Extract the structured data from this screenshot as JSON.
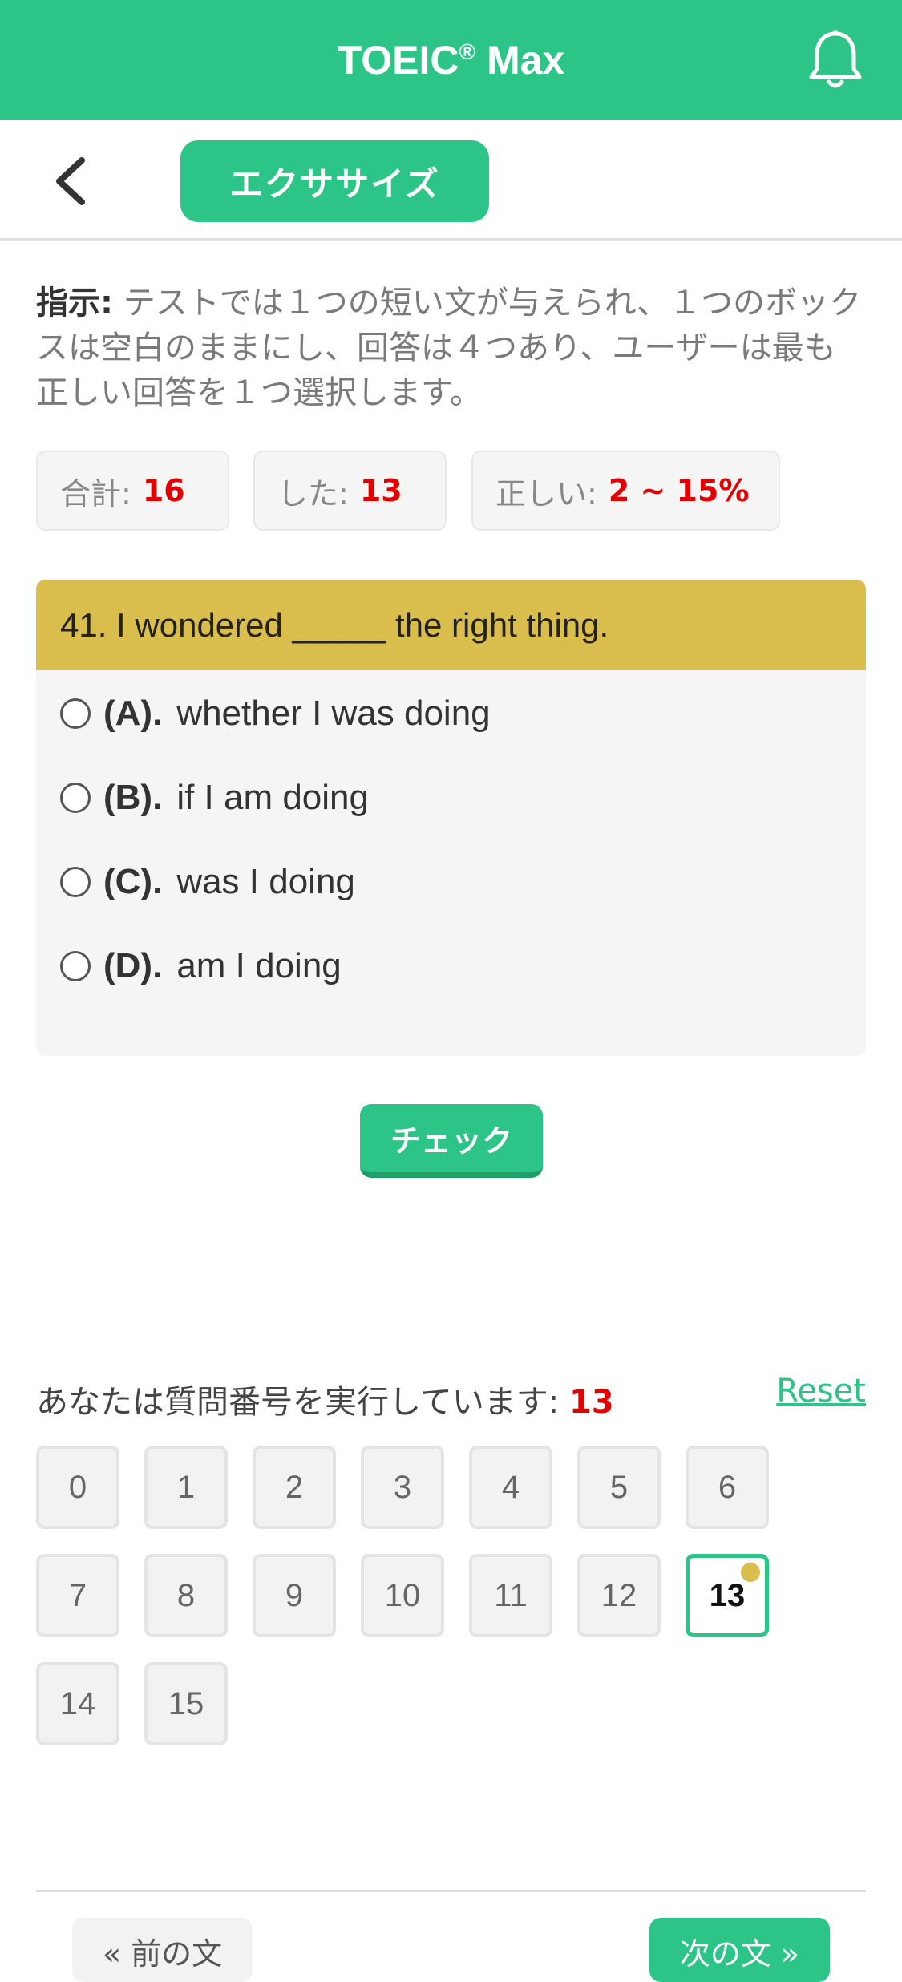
{
  "header": {
    "title": "TOEIC",
    "title_mark": "®",
    "title_suffix": " Max",
    "bell_icon": "bell-icon"
  },
  "nav": {
    "back_icon": "chevron-left-icon",
    "exercise_label": "エクササイズ"
  },
  "instructions": {
    "label": "指示:",
    "text": " テストでは１つの短い文が与えられ、１つのボックスは空白のままにし、回答は４つあり、ユーザーは最も正しい回答を１つ選択します。"
  },
  "stats": {
    "total_label": "合計:",
    "total_value": "16",
    "done_label": "した:",
    "done_value": "13",
    "correct_label": "正しい:",
    "correct_value": "2 ~ 15%"
  },
  "question": {
    "text": "41. I wondered _____ the right thing.",
    "options": [
      {
        "letter": "(A).",
        "text": "whether I was doing"
      },
      {
        "letter": "(B).",
        "text": "if I am doing"
      },
      {
        "letter": "(C).",
        "text": "was I doing"
      },
      {
        "letter": "(D).",
        "text": "am I doing"
      }
    ]
  },
  "check_label": "チェック",
  "progress": {
    "label": "あなたは質問番号を実行しています:",
    "current": "13",
    "reset_label": "Reset"
  },
  "question_numbers": [
    "0",
    "1",
    "2",
    "3",
    "4",
    "5",
    "6",
    "7",
    "8",
    "9",
    "10",
    "11",
    "12",
    "13",
    "14",
    "15"
  ],
  "footer": {
    "prev_label": "« 前の文",
    "next_label": "次の文 »"
  },
  "colors": {
    "brand": "#2cc487",
    "question_header": "#d9bd4d",
    "highlight": "#e30000"
  }
}
